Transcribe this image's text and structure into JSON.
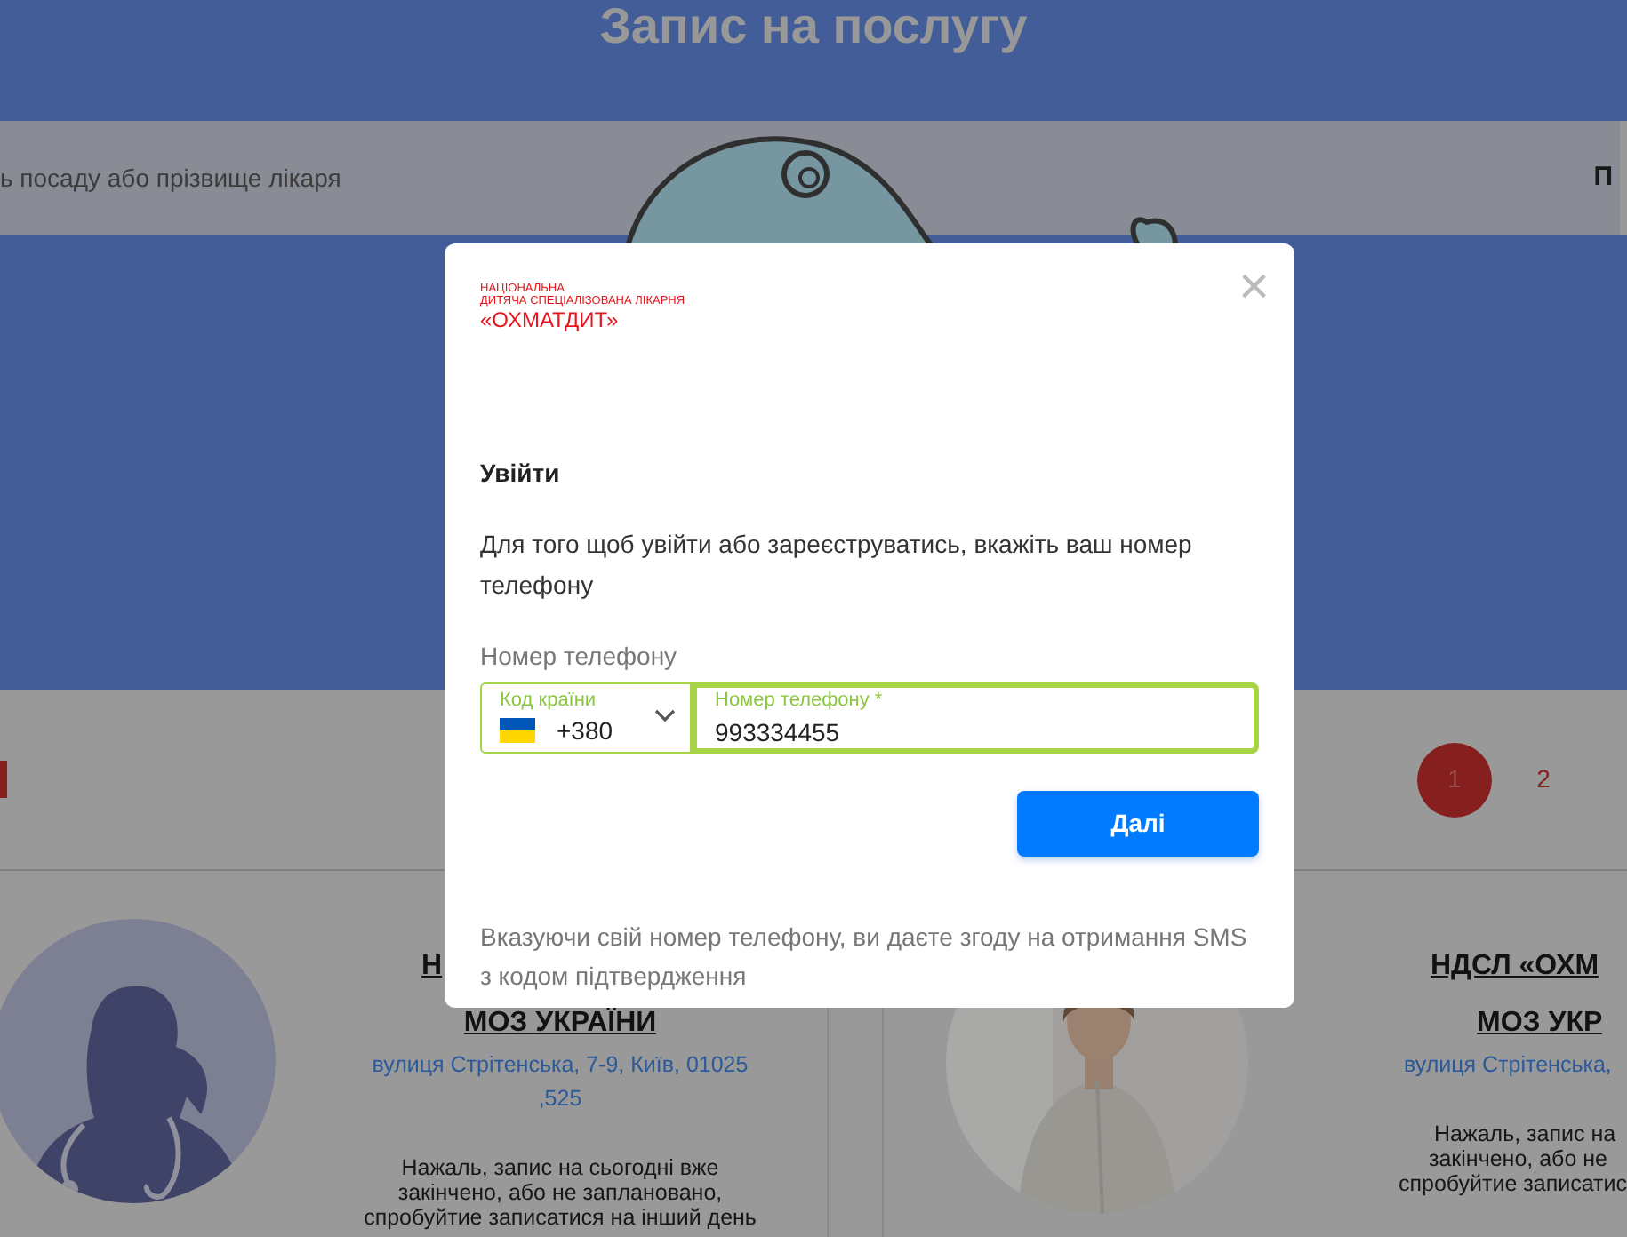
{
  "page": {
    "title": "Запис на послугу",
    "search": {
      "placeholder": "ь посаду або прізвище лікаря",
      "button_text": "П"
    }
  },
  "pagination": [
    {
      "label": "1",
      "selected": true
    },
    {
      "label": "2",
      "selected": false
    }
  ],
  "cards": [
    {
      "kind": "silhouette",
      "title_lines": [
        "Н",
        "МОЗ УКРАЇНИ"
      ],
      "address_lines": [
        "вулиця Стрітенська, 7-9, Київ, 01025",
        ",525"
      ],
      "message_lines": [
        "Нажаль, запис на сьогодні вже",
        "закінчено, або не заплановано,",
        "спробуйтие записатися на інший день"
      ]
    },
    {
      "title_lines": [
        "НДСЛ «ОХМ",
        "МОЗ УКР"
      ],
      "address_lines": [
        "вулиця Стрітенська,"
      ],
      "message_lines": [
        "Нажаль, запис на",
        "закінчено, або не",
        "спробуйтие записатис"
      ]
    }
  ],
  "modal": {
    "logo_lines": [
      "НАЦІОНАЛЬНА",
      "ДИТЯЧА СПЕЦІАЛІЗОВАНА ЛІКАРНЯ",
      "«ОХМАТДИТ»"
    ],
    "close": "×",
    "heading": "Увійти",
    "text": "Для того щоб увійти або зареєструватись, вкажіть ваш номер телефону",
    "field_label": "Номер телефону",
    "country_field": {
      "label": "Код країни",
      "value": "+380"
    },
    "phone_field": {
      "label": "Номер телефону *",
      "value": "993334455",
      "focused": true
    },
    "submit": "Далі",
    "note": "Вказуючи свій номер телефону, ви даєте згоду на отримання SMS з кодом підтвердження"
  }
}
